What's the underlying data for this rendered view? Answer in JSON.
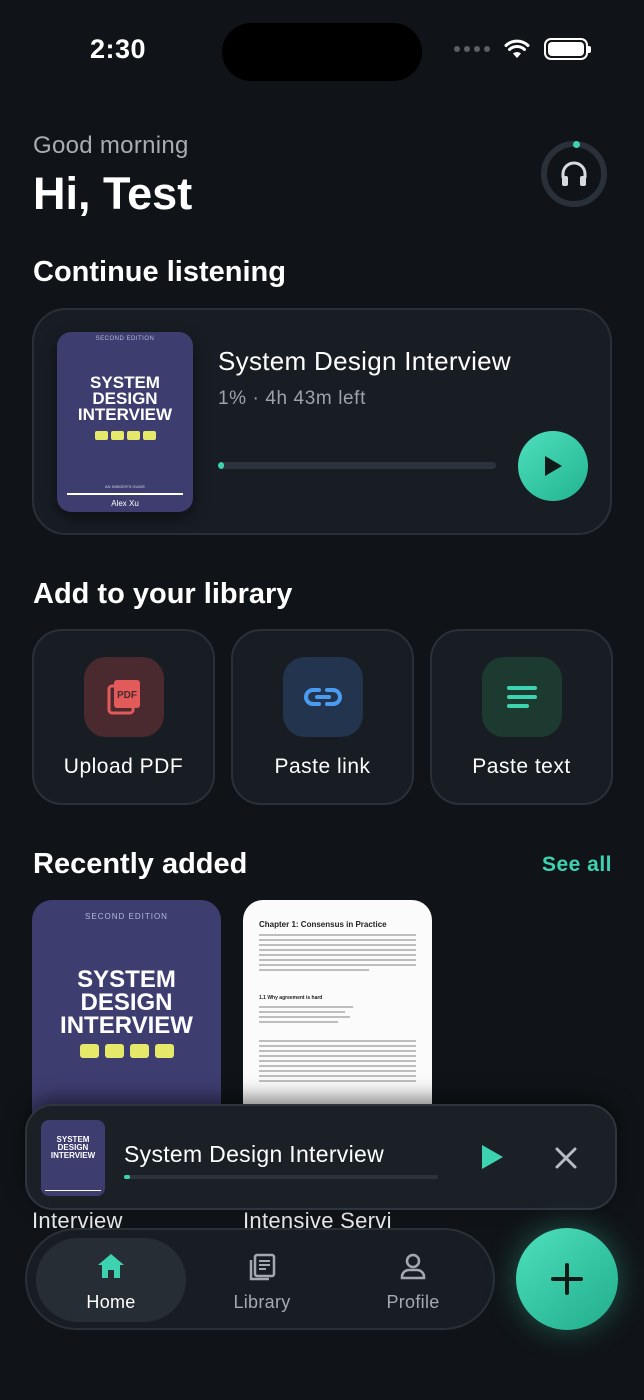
{
  "status_bar": {
    "time": "2:30"
  },
  "header": {
    "greeting": "Good morning",
    "title": "Hi, Test"
  },
  "continue_listening": {
    "section_title": "Continue listening",
    "book_title": "System Design Interview",
    "progress_text": "1% · 4h 43m left",
    "progress_fraction": 0.01,
    "cover": {
      "edition": "SECOND EDITION",
      "title": "SYSTEM DESIGN INTERVIEW",
      "authors": "AN INSIDER'S GUIDE",
      "author": "Alex Xu"
    }
  },
  "add_library": {
    "section_title": "Add to your library",
    "items": [
      {
        "label": "Upload PDF",
        "icon": "pdf-icon",
        "color": "#e25a5a"
      },
      {
        "label": "Paste link",
        "icon": "link-icon",
        "color": "#4b9cf0"
      },
      {
        "label": "Paste text",
        "icon": "text-lines-icon",
        "color": "#3ed3b0"
      }
    ]
  },
  "recent": {
    "section_title": "Recently added",
    "see_all": "See all",
    "items": [
      {
        "label": "Interview",
        "cover_edition": "SECOND EDITION",
        "cover_title": "SYSTEM DESIGN INTERVIEW"
      },
      {
        "label": "Intensive Servi",
        "doc_heading": "Chapter 1: Consensus in Practice",
        "doc_subheading": "1.1 Why agreement is hard"
      }
    ]
  },
  "mini_player": {
    "title": "System Design Interview",
    "progress_fraction": 0.01,
    "cover_title": "SYSTEM DESIGN INTERVIEW"
  },
  "nav": {
    "items": [
      {
        "label": "Home",
        "icon": "home-icon",
        "active": true
      },
      {
        "label": "Library",
        "icon": "library-icon",
        "active": false
      },
      {
        "label": "Profile",
        "icon": "profile-icon",
        "active": false
      }
    ]
  },
  "colors": {
    "accent": "#3ed3b0",
    "background": "#101418",
    "card": "#181d24"
  }
}
